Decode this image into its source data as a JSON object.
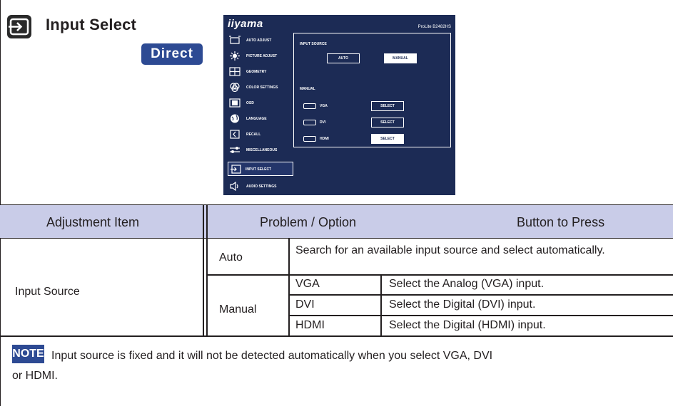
{
  "header": {
    "title": "Input Select",
    "direct_label": "Direct"
  },
  "osd": {
    "brand": "iiyama",
    "model": "ProLite B2482HS",
    "menu": [
      {
        "label": "AUTO ADJUST",
        "icon": "auto-adjust-icon"
      },
      {
        "label": "PICTURE ADJUST",
        "icon": "picture-adjust-icon"
      },
      {
        "label": "GEOMETRY",
        "icon": "geometry-icon"
      },
      {
        "label": "COLOR SETTINGS",
        "icon": "color-settings-icon"
      },
      {
        "label": "OSD",
        "icon": "osd-icon"
      },
      {
        "label": "LANGUAGE",
        "icon": "language-icon"
      },
      {
        "label": "RECALL",
        "icon": "recall-icon"
      },
      {
        "label": "MISCELLANEOUS",
        "icon": "miscellaneous-icon"
      },
      {
        "label": "INPUT SELECT",
        "icon": "input-select-icon",
        "active": true
      },
      {
        "label": "AUDIO SETTINGS",
        "icon": "audio-settings-icon"
      }
    ],
    "input_source_label": "INPUT SOURCE",
    "auto_label": "AUTO",
    "manual_button_label": "MANUAL",
    "manual_label": "MANUAL",
    "ports": [
      {
        "label": "VGA",
        "button": "SELECT"
      },
      {
        "label": "DVI",
        "button": "SELECT"
      },
      {
        "label": "HDMI",
        "button": "SELECT",
        "selected": true
      }
    ]
  },
  "table": {
    "headers": {
      "adjustment_item": "Adjustment Item",
      "problem_option": "Problem / Option",
      "button_to_press": "Button to Press"
    },
    "item": "Input Source",
    "auto": {
      "option": "Auto",
      "description": "Search for an available input source and select automatically."
    },
    "manual": {
      "option": "Manual",
      "rows": [
        {
          "port": "VGA",
          "description": "Select the Analog (VGA) input."
        },
        {
          "port": "DVI",
          "description": "Select the Digital (DVI) input."
        },
        {
          "port": "HDMI",
          "description": "Select the Digital (HDMI) input."
        }
      ]
    }
  },
  "note": {
    "badge": "NOTE",
    "text_line1": "Input source is fixed and it will not be detected automatically when you select VGA, DVI",
    "text_line2": "or HDMI."
  },
  "colors": {
    "header_band": "#c9cce8",
    "accent_blue": "#2d4a93",
    "osd_background": "#1c2b55"
  }
}
